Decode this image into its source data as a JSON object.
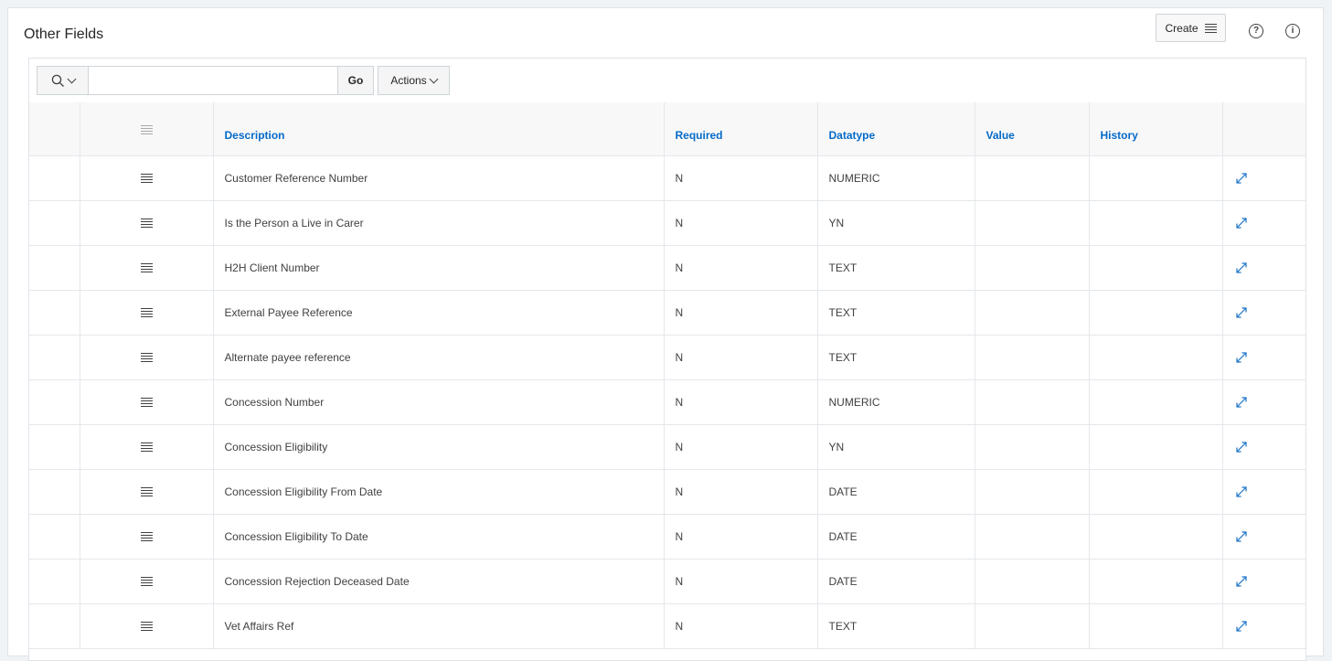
{
  "region": {
    "title": "Other Fields",
    "create_label": "Create",
    "help_icon": "question-circle-icon",
    "info_icon": "info-circle-icon"
  },
  "toolbar": {
    "search_placeholder": "",
    "search_value": "",
    "go_label": "Go",
    "actions_label": "Actions"
  },
  "table": {
    "headers": [
      "Description",
      "Required",
      "Datatype",
      "Value",
      "History"
    ],
    "rows": [
      {
        "description": "Customer Reference Number",
        "required": "N",
        "datatype": "NUMERIC",
        "value": "",
        "history": ""
      },
      {
        "description": "Is the Person a Live in Carer",
        "required": "N",
        "datatype": "YN",
        "value": "",
        "history": ""
      },
      {
        "description": "H2H Client Number",
        "required": "N",
        "datatype": "TEXT",
        "value": "",
        "history": ""
      },
      {
        "description": "External Payee Reference",
        "required": "N",
        "datatype": "TEXT",
        "value": "",
        "history": ""
      },
      {
        "description": "Alternate payee reference",
        "required": "N",
        "datatype": "TEXT",
        "value": "",
        "history": ""
      },
      {
        "description": "Concession Number",
        "required": "N",
        "datatype": "NUMERIC",
        "value": "",
        "history": ""
      },
      {
        "description": "Concession Eligibility",
        "required": "N",
        "datatype": "YN",
        "value": "",
        "history": ""
      },
      {
        "description": "Concession Eligibility From Date",
        "required": "N",
        "datatype": "DATE",
        "value": "",
        "history": ""
      },
      {
        "description": "Concession Eligibility To Date",
        "required": "N",
        "datatype": "DATE",
        "value": "",
        "history": ""
      },
      {
        "description": "Concession Rejection Deceased Date",
        "required": "N",
        "datatype": "DATE",
        "value": "",
        "history": ""
      },
      {
        "description": "Vet Affairs Ref",
        "required": "N",
        "datatype": "TEXT",
        "value": "",
        "history": ""
      }
    ]
  },
  "colors": {
    "header_link": "#056ac8",
    "expand_icon": "#1a73c8",
    "border": "#e4e7eb"
  }
}
